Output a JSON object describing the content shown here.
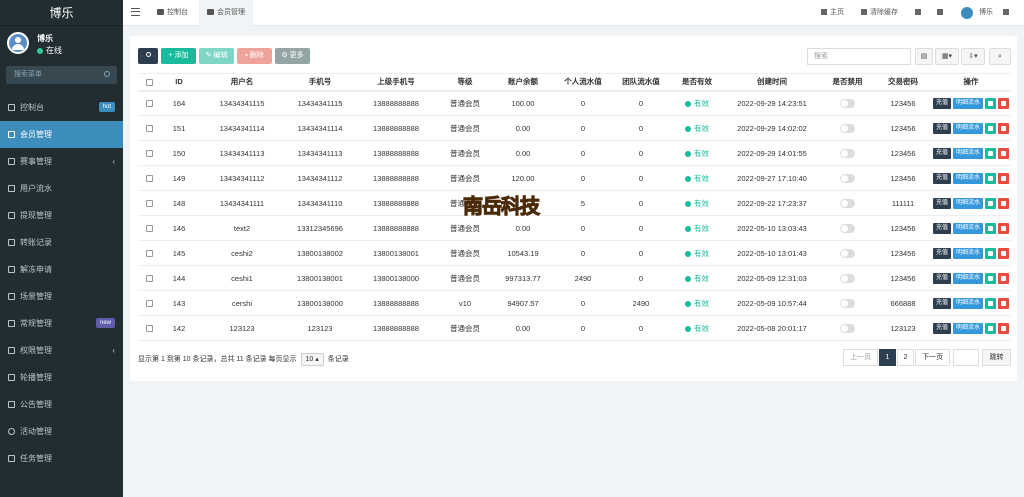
{
  "app": {
    "brand": "博乐"
  },
  "user": {
    "name": "博乐",
    "status": "在线"
  },
  "sidebar": {
    "search_placeholder": "搜索菜单",
    "items": [
      {
        "label": "控制台",
        "badge": "hot",
        "badge_color": "#3c8dbc",
        "active": false
      },
      {
        "label": "会员管理",
        "active": true
      },
      {
        "label": "赛事管理",
        "caret": "‹",
        "active": false
      },
      {
        "label": "用户流水",
        "active": false
      },
      {
        "label": "提现管理",
        "active": false
      },
      {
        "label": "转账记录",
        "active": false
      },
      {
        "label": "解冻申请",
        "active": false
      },
      {
        "label": "场景管理",
        "active": false
      },
      {
        "label": "常规管理",
        "badge": "new",
        "badge_color": "#605ca8",
        "active": false
      },
      {
        "label": "权限管理",
        "caret": "‹",
        "active": false
      },
      {
        "label": "轮播管理",
        "active": false
      },
      {
        "label": "公告管理",
        "active": false
      },
      {
        "label": "活动管理",
        "active": false
      },
      {
        "label": "任务管理",
        "active": false
      }
    ]
  },
  "topbar": {
    "tabs": [
      {
        "label": "控制台"
      },
      {
        "label": "会员管理"
      }
    ],
    "home": "主页",
    "clear_cache": "清除缓存",
    "username": "博乐"
  },
  "toolbar": {
    "refresh_icon": "refresh-icon",
    "add": "添加",
    "edit": "编辑",
    "delete": "删除",
    "more": "更多",
    "search_placeholder": "搜索",
    "colors": {
      "primary": "#2c3e50",
      "success": "#18bc9c",
      "danger": "#e74c3c",
      "info": "#3498db"
    }
  },
  "table": {
    "columns": [
      "ID",
      "用户名",
      "手机号",
      "上级手机号",
      "等级",
      "账户余额",
      "个人流水值",
      "团队流水值",
      "是否有效",
      "创建时间",
      "是否禁用",
      "交易密码",
      "操作"
    ],
    "rows": [
      {
        "id": "164",
        "username": "13434341115",
        "phone": "13434341115",
        "parent": "13888888888",
        "level": "普通会员",
        "balance": "100.00",
        "personal": "0",
        "team": "0",
        "valid": "有效",
        "created": "2022-09-29 14:23:51",
        "pwd": "123456"
      },
      {
        "id": "151",
        "username": "13434341114",
        "phone": "13434341114",
        "parent": "13888888888",
        "level": "普通会员",
        "balance": "0.00",
        "personal": "0",
        "team": "0",
        "valid": "有效",
        "created": "2022-09-29 14:02:02",
        "pwd": "123456"
      },
      {
        "id": "150",
        "username": "13434341113",
        "phone": "13434341113",
        "parent": "13888888888",
        "level": "普通会员",
        "balance": "0.00",
        "personal": "0",
        "team": "0",
        "valid": "有效",
        "created": "2022-09-29 14:01:55",
        "pwd": "123456"
      },
      {
        "id": "149",
        "username": "13434341112",
        "phone": "13434341112",
        "parent": "13888888888",
        "level": "普通会员",
        "balance": "120.00",
        "personal": "0",
        "team": "0",
        "valid": "有效",
        "created": "2022-09-27 17:10:40",
        "pwd": "123456"
      },
      {
        "id": "148",
        "username": "13434341111",
        "phone": "13434341110",
        "parent": "13888888888",
        "level": "普通会员",
        "balance": "",
        "personal": "5",
        "team": "0",
        "valid": "有效",
        "created": "2022-09-22 17:23:37",
        "pwd": "111111"
      },
      {
        "id": "146",
        "username": "text2",
        "phone": "13312345696",
        "parent": "13888888888",
        "level": "普通会员",
        "balance": "0.00",
        "personal": "0",
        "team": "0",
        "valid": "有效",
        "created": "2022-05-10 13:03:43",
        "pwd": "123456"
      },
      {
        "id": "145",
        "username": "ceshi2",
        "phone": "13800138002",
        "parent": "13800138001",
        "level": "普通会员",
        "balance": "10543.19",
        "personal": "0",
        "team": "0",
        "valid": "有效",
        "created": "2022-05-10 13:01:43",
        "pwd": "123456"
      },
      {
        "id": "144",
        "username": "ceshi1",
        "phone": "13800138001",
        "parent": "13800138000",
        "level": "普通会员",
        "balance": "997313.77",
        "personal": "2490",
        "team": "0",
        "valid": "有效",
        "created": "2022-05-09 12:31:03",
        "pwd": "123456"
      },
      {
        "id": "143",
        "username": "cershi",
        "phone": "13800138000",
        "parent": "13888888888",
        "level": "v10",
        "balance": "94907.57",
        "personal": "0",
        "team": "2490",
        "valid": "有效",
        "created": "2022-05-09 10:57:44",
        "pwd": "666888"
      },
      {
        "id": "142",
        "username": "123123",
        "phone": "123123",
        "parent": "13888888888",
        "level": "普通会员",
        "balance": "0.00",
        "personal": "0",
        "team": "0",
        "valid": "有效",
        "created": "2022-05-08 20:01:17",
        "pwd": "123123"
      }
    ],
    "ops": {
      "recharge": "充值",
      "flow": "明细流水"
    }
  },
  "footer": {
    "summary_prefix": "显示第 1 到第 10 条记录，总共 11 条记录 每页显示",
    "page_size": "10",
    "summary_suffix": "条记录"
  },
  "pagination": {
    "prev": "上一页",
    "pages": [
      "1",
      "2"
    ],
    "current": "1",
    "next": "下一页",
    "jump": "跳转"
  },
  "watermark": {
    "text": "南岳科技"
  }
}
